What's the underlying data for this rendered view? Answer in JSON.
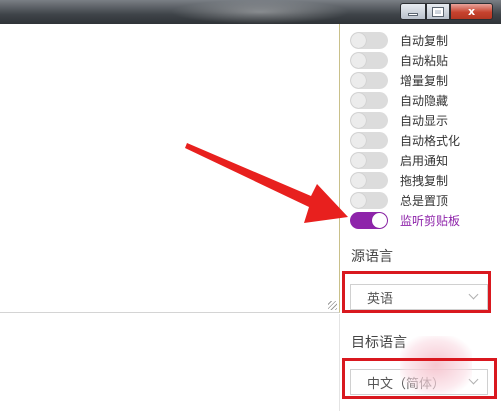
{
  "window": {
    "controls": [
      {
        "name": "minimize",
        "icon": "minimize-icon"
      },
      {
        "name": "maximize",
        "icon": "maximize-icon"
      },
      {
        "name": "close",
        "icon": "close-icon",
        "glyph": "x"
      }
    ]
  },
  "options": [
    {
      "label": "自动复制",
      "on": false
    },
    {
      "label": "自动粘贴",
      "on": false
    },
    {
      "label": "增量复制",
      "on": false
    },
    {
      "label": "自动隐藏",
      "on": false
    },
    {
      "label": "自动显示",
      "on": false
    },
    {
      "label": "自动格式化",
      "on": false
    },
    {
      "label": "启用通知",
      "on": false
    },
    {
      "label": "拖拽复制",
      "on": false
    },
    {
      "label": "总是置顶",
      "on": false
    },
    {
      "label": "监听剪贴板",
      "on": true
    }
  ],
  "source_language": {
    "label": "源语言",
    "selected": "英语"
  },
  "target_language": {
    "label": "目标语言",
    "selected": "中文（简体）"
  },
  "colors": {
    "accent": "#8e24aa",
    "highlight": "#d9181f",
    "arrow": "#e8201e"
  }
}
